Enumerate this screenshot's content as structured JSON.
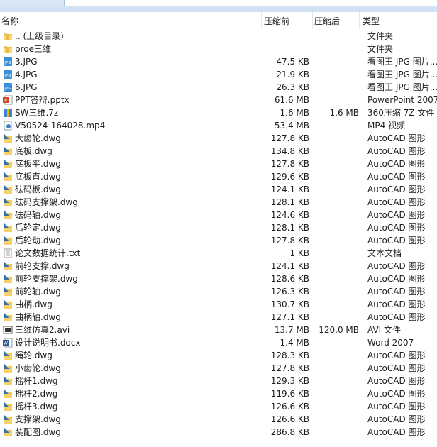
{
  "header": {
    "name": "名称",
    "before": "压缩前",
    "after": "压缩后",
    "type": "类型"
  },
  "files": [
    {
      "name": ".. (上级目录)",
      "before": "",
      "after": "",
      "type": "文件夹",
      "icon": "folder"
    },
    {
      "name": "proe三维",
      "before": "",
      "after": "",
      "type": "文件夹",
      "icon": "folder"
    },
    {
      "name": "3.JPG",
      "before": "47.5 KB",
      "after": "",
      "type": "看图王 JPG 图片...",
      "icon": "jpg"
    },
    {
      "name": "4.JPG",
      "before": "21.9 KB",
      "after": "",
      "type": "看图王 JPG 图片...",
      "icon": "jpg"
    },
    {
      "name": "6.JPG",
      "before": "26.3 KB",
      "after": "",
      "type": "看图王 JPG 图片...",
      "icon": "jpg"
    },
    {
      "name": "PPT答辩.pptx",
      "before": "61.6 MB",
      "after": "",
      "type": "PowerPoint 2007",
      "icon": "pptx"
    },
    {
      "name": "SW三维.7z",
      "before": "1.6 MB",
      "after": "1.6 MB",
      "type": "360压缩 7Z 文件",
      "icon": "archive"
    },
    {
      "name": "V50524-164028.mp4",
      "before": "53.4 MB",
      "after": "",
      "type": "MP4 视频",
      "icon": "video"
    },
    {
      "name": "大齿轮.dwg",
      "before": "127.8 KB",
      "after": "",
      "type": "AutoCAD 图形",
      "icon": "dwg"
    },
    {
      "name": "底板.dwg",
      "before": "134.8 KB",
      "after": "",
      "type": "AutoCAD 图形",
      "icon": "dwg"
    },
    {
      "name": "底板平.dwg",
      "before": "127.8 KB",
      "after": "",
      "type": "AutoCAD 图形",
      "icon": "dwg"
    },
    {
      "name": "底板直.dwg",
      "before": "129.6 KB",
      "after": "",
      "type": "AutoCAD 图形",
      "icon": "dwg"
    },
    {
      "name": "砝码板.dwg",
      "before": "124.1 KB",
      "after": "",
      "type": "AutoCAD 图形",
      "icon": "dwg"
    },
    {
      "name": "砝码支撑架.dwg",
      "before": "128.1 KB",
      "after": "",
      "type": "AutoCAD 图形",
      "icon": "dwg"
    },
    {
      "name": "砝码轴.dwg",
      "before": "124.6 KB",
      "after": "",
      "type": "AutoCAD 图形",
      "icon": "dwg"
    },
    {
      "name": "后轮定.dwg",
      "before": "128.1 KB",
      "after": "",
      "type": "AutoCAD 图形",
      "icon": "dwg"
    },
    {
      "name": "后轮动.dwg",
      "before": "127.8 KB",
      "after": "",
      "type": "AutoCAD 图形",
      "icon": "dwg"
    },
    {
      "name": "论文数据统计.txt",
      "before": "1 KB",
      "after": "",
      "type": "文本文档",
      "icon": "txt"
    },
    {
      "name": "前轮支撑.dwg",
      "before": "124.1 KB",
      "after": "",
      "type": "AutoCAD 图形",
      "icon": "dwg"
    },
    {
      "name": "前轮支撑架.dwg",
      "before": "128.6 KB",
      "after": "",
      "type": "AutoCAD 图形",
      "icon": "dwg"
    },
    {
      "name": "前轮轴.dwg",
      "before": "126.3 KB",
      "after": "",
      "type": "AutoCAD 图形",
      "icon": "dwg"
    },
    {
      "name": "曲柄.dwg",
      "before": "130.7 KB",
      "after": "",
      "type": "AutoCAD 图形",
      "icon": "dwg"
    },
    {
      "name": "曲柄轴.dwg",
      "before": "127.1 KB",
      "after": "",
      "type": "AutoCAD 图形",
      "icon": "dwg"
    },
    {
      "name": "三维仿真2.avi",
      "before": "13.7 MB",
      "after": "120.0 MB",
      "type": "AVI 文件",
      "icon": "avi"
    },
    {
      "name": "设计说明书.docx",
      "before": "1.4 MB",
      "after": "",
      "type": "Word 2007",
      "icon": "docx"
    },
    {
      "name": "绳轮.dwg",
      "before": "128.3 KB",
      "after": "",
      "type": "AutoCAD 图形",
      "icon": "dwg"
    },
    {
      "name": "小齿轮.dwg",
      "before": "127.8 KB",
      "after": "",
      "type": "AutoCAD 图形",
      "icon": "dwg"
    },
    {
      "name": "摇杆1.dwg",
      "before": "129.3 KB",
      "after": "",
      "type": "AutoCAD 图形",
      "icon": "dwg"
    },
    {
      "name": "摇杆2.dwg",
      "before": "119.6 KB",
      "after": "",
      "type": "AutoCAD 图形",
      "icon": "dwg"
    },
    {
      "name": "摇杆3.dwg",
      "before": "126.6 KB",
      "after": "",
      "type": "AutoCAD 图形",
      "icon": "dwg"
    },
    {
      "name": "支撑架.dwg",
      "before": "126.6 KB",
      "after": "",
      "type": "AutoCAD 图形",
      "icon": "dwg"
    },
    {
      "name": "装配图.dwg",
      "before": "286.8 KB",
      "after": "",
      "type": "AutoCAD 图形",
      "icon": "dwg"
    }
  ]
}
